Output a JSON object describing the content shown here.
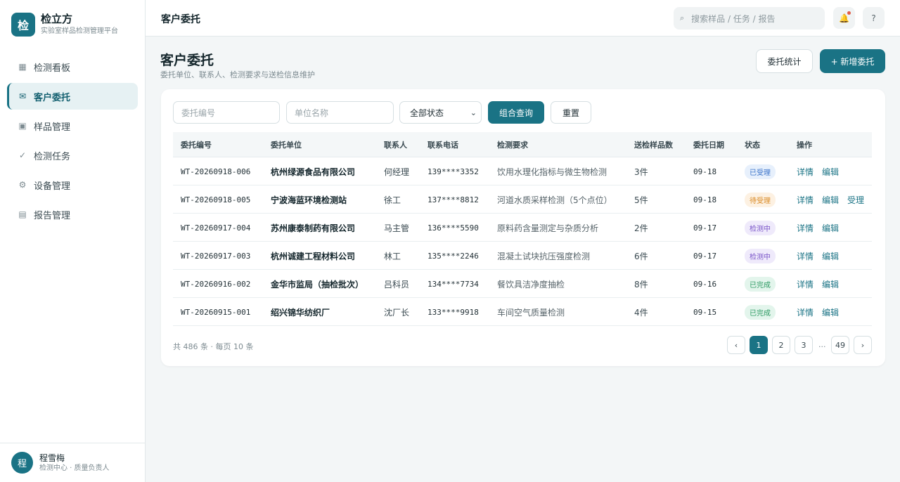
{
  "brand": {
    "logo": "检",
    "name": "检立方",
    "subtitle": "实验室样品检测管理平台"
  },
  "nav": [
    {
      "icon": "▦",
      "label": "检测看板"
    },
    {
      "icon": "✉",
      "label": "客户委托"
    },
    {
      "icon": "▣",
      "label": "样品管理"
    },
    {
      "icon": "✓",
      "label": "检测任务"
    },
    {
      "icon": "⚙",
      "label": "设备管理"
    },
    {
      "icon": "▤",
      "label": "报告管理"
    }
  ],
  "user": {
    "avatar": "程",
    "name": "程雪梅",
    "role": "检测中心 · 质量负责人"
  },
  "topbar": {
    "title": "客户委托",
    "search_icon": "⌕",
    "search_placeholder": "搜索样品 / 任务 / 报告",
    "bell": "🔔",
    "help": "?"
  },
  "page": {
    "title": "客户委托",
    "subtitle": "委托单位、联系人、检测要求与送检信息维护",
    "stats_button": "委托统计",
    "new_button": "+ 新增委托"
  },
  "filters": {
    "no_placeholder": "委托编号",
    "unit_placeholder": "单位名称",
    "status_value": "全部状态",
    "status_chevron": "⌄",
    "query_button": "组合查询",
    "reset_button": "重置"
  },
  "table": {
    "headers": [
      "委托编号",
      "委托单位",
      "联系人",
      "联系电话",
      "检测要求",
      "送检样品数",
      "委托日期",
      "状态",
      "操作"
    ],
    "rows": [
      {
        "no": "WT-20260918-006",
        "unit": "杭州绿源食品有限公司",
        "contact": "何经理",
        "phone": "139****3352",
        "req": "饮用水理化指标与微生物检测",
        "count": "3件",
        "date": "09-18",
        "status": "已受理",
        "status_type": "accepted",
        "actions": [
          "详情",
          "编辑"
        ]
      },
      {
        "no": "WT-20260918-005",
        "unit": "宁波海蓝环境检测站",
        "contact": "徐工",
        "phone": "137****8812",
        "req": "河道水质采样检测（5个点位）",
        "count": "5件",
        "date": "09-18",
        "status": "待受理",
        "status_type": "pending",
        "actions": [
          "详情",
          "编辑",
          "受理"
        ]
      },
      {
        "no": "WT-20260917-004",
        "unit": "苏州康泰制药有限公司",
        "contact": "马主管",
        "phone": "136****5590",
        "req": "原料药含量测定与杂质分析",
        "count": "2件",
        "date": "09-17",
        "status": "检测中",
        "status_type": "testing",
        "actions": [
          "详情",
          "编辑"
        ]
      },
      {
        "no": "WT-20260917-003",
        "unit": "杭州诚建工程材料公司",
        "contact": "林工",
        "phone": "135****2246",
        "req": "混凝土试块抗压强度检测",
        "count": "6件",
        "date": "09-17",
        "status": "检测中",
        "status_type": "testing",
        "actions": [
          "详情",
          "编辑"
        ]
      },
      {
        "no": "WT-20260916-002",
        "unit": "金华市监局（抽检批次）",
        "contact": "吕科员",
        "phone": "134****7734",
        "req": "餐饮具洁净度抽检",
        "count": "8件",
        "date": "09-16",
        "status": "已完成",
        "status_type": "done",
        "actions": [
          "详情",
          "编辑"
        ]
      },
      {
        "no": "WT-20260915-001",
        "unit": "绍兴锦华纺织厂",
        "contact": "沈厂长",
        "phone": "133****9918",
        "req": "车间空气质量检测",
        "count": "4件",
        "date": "09-15",
        "status": "已完成",
        "status_type": "done",
        "actions": [
          "详情",
          "编辑"
        ]
      }
    ]
  },
  "pagination": {
    "summary": "共 486 条 · 每页 10 条",
    "prev": "‹",
    "pages": [
      "1",
      "2",
      "3"
    ],
    "ellipsis": "...",
    "last": "49",
    "next": "›"
  }
}
